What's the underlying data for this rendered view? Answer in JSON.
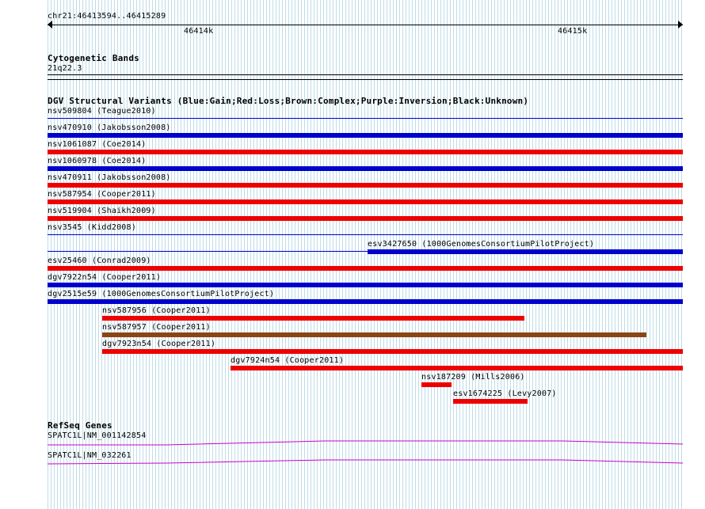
{
  "ruler": {
    "range_label": "chr21:46413594..46415289",
    "ticks": [
      "46414k",
      "46415k"
    ]
  },
  "cytoband": {
    "title": "Cytogenetic Bands",
    "band": "21q22.3"
  },
  "dgv": {
    "title": "DGV Structural Variants (Blue:Gain;Red:Loss;Brown:Complex;Purple:Inversion;Black:Unknown)",
    "colors": {
      "gain": "#0000cc",
      "loss": "#ee0000",
      "complex": "#8b4513",
      "thin": "#0000cc"
    },
    "variants": [
      {
        "label": "nsv509804 (Teague2010)",
        "type": "thin",
        "start": 0.0,
        "end": 1.0
      },
      {
        "label": "nsv470910 (Jakobsson2008)",
        "type": "gain",
        "start": 0.0,
        "end": 1.0
      },
      {
        "label": "nsv1061087 (Coe2014)",
        "type": "loss",
        "start": 0.0,
        "end": 1.0
      },
      {
        "label": "nsv1060978 (Coe2014)",
        "type": "gain",
        "start": 0.0,
        "end": 1.0
      },
      {
        "label": "nsv470911 (Jakobsson2008)",
        "type": "loss",
        "start": 0.0,
        "end": 1.0
      },
      {
        "label": "nsv587954 (Cooper2011)",
        "type": "loss",
        "start": 0.0,
        "end": 1.0
      },
      {
        "label": "nsv519904 (Shaikh2009)",
        "type": "loss",
        "start": 0.0,
        "end": 1.0
      },
      {
        "label": "nsv3545 (Kidd2008)",
        "type": "thin",
        "start": 0.0,
        "end": 1.0
      },
      {
        "label": "esv3427650 (1000GenomesConsortiumPilotProject)",
        "type": "gain",
        "start": 0.504,
        "end": 1.0,
        "thin_left": true
      },
      {
        "label": "esv25460 (Conrad2009)",
        "type": "loss",
        "start": 0.0,
        "end": 1.0
      },
      {
        "label": "dgv7922n54 (Cooper2011)",
        "type": "gain",
        "start": 0.0,
        "end": 1.0
      },
      {
        "label": "dgv2515e59 (1000GenomesConsortiumPilotProject)",
        "type": "gain",
        "start": 0.0,
        "end": 1.0
      },
      {
        "label": "nsv587956 (Cooper2011)",
        "type": "loss",
        "start": 0.086,
        "end": 0.751
      },
      {
        "label": "nsv587957 (Cooper2011)",
        "type": "complex",
        "start": 0.086,
        "end": 0.943
      },
      {
        "label": "dgv7923n54 (Cooper2011)",
        "type": "loss",
        "start": 0.086,
        "end": 1.0
      },
      {
        "label": "dgv7924n54 (Cooper2011)",
        "type": "loss",
        "start": 0.288,
        "end": 1.0
      },
      {
        "label": "nsv187209 (Mills2006)",
        "type": "loss",
        "start": 0.588,
        "end": 0.635
      },
      {
        "label": "esv1674225 (Levy2007)",
        "type": "loss",
        "start": 0.638,
        "end": 0.755
      }
    ]
  },
  "refseq": {
    "title": "RefSeq Genes",
    "color": "#cc00cc",
    "genes": [
      {
        "label": "SPATC1L|NM_001142854"
      },
      {
        "label": "SPATC1L|NM_032261"
      }
    ]
  }
}
